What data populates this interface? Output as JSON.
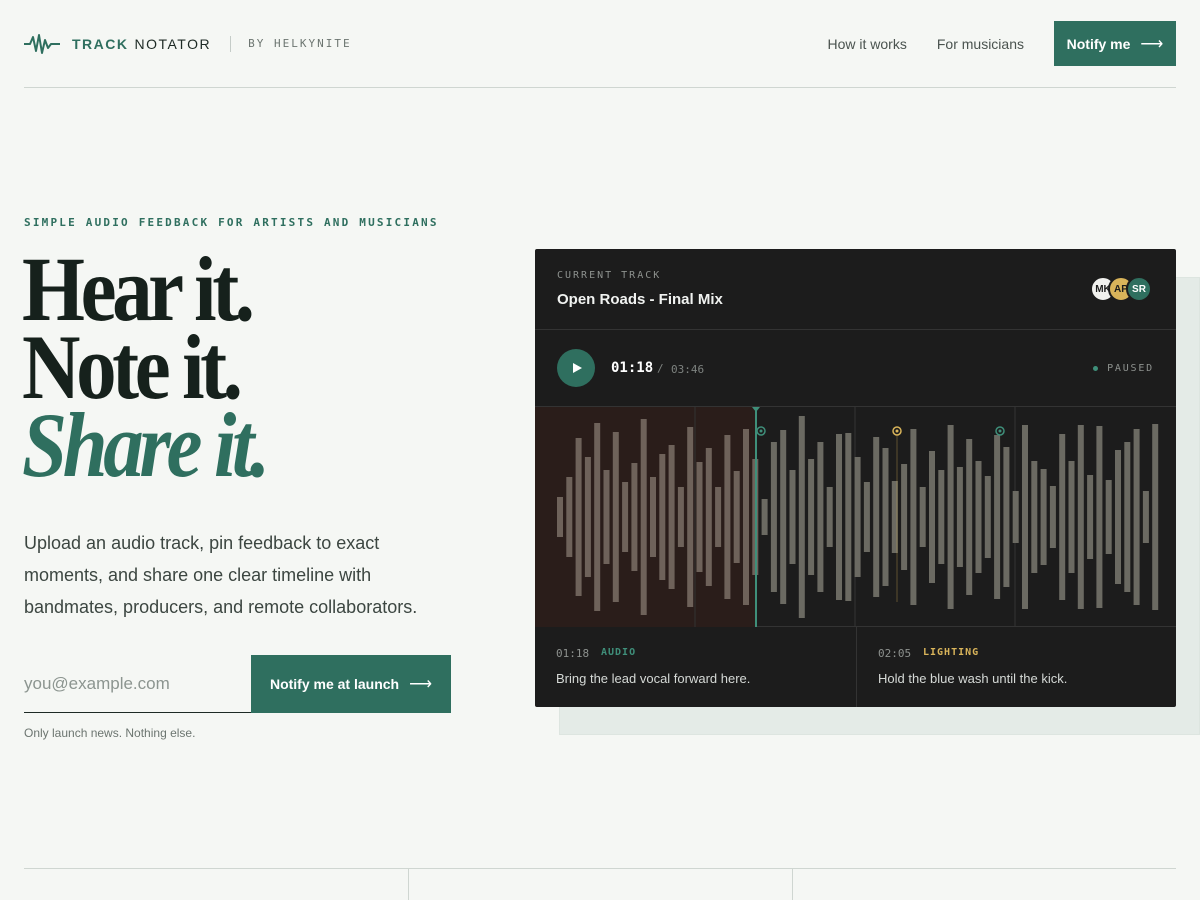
{
  "brand": {
    "track": "TRACK",
    "notator": "NOTATOR",
    "by": "BY HELKYNITE",
    "icon": "waveform-icon"
  },
  "nav": {
    "links": [
      "How it works",
      "For musicians"
    ],
    "cta": "Notify me"
  },
  "hero": {
    "eyebrow": "SIMPLE AUDIO FEEDBACK FOR ARTISTS AND MUSICIANS",
    "line1": "Hear it.",
    "line2": "Note it.",
    "line3": "Share it.",
    "subcopy": "Upload an audio track, pin feedback to exact moments, and share one clear timeline with bandmates, producers, and remote collaborators.",
    "email_placeholder": "you@example.com",
    "signup_cta": "Notify me at launch",
    "fineprint": "Only launch news. Nothing else."
  },
  "player": {
    "label": "CURRENT TRACK",
    "title": "Open Roads - Final Mix",
    "avatars": [
      {
        "initials": "MK",
        "bg": "#f1f1ee",
        "fg": "#1c1c1c"
      },
      {
        "initials": "AP",
        "bg": "#d9b45a",
        "fg": "#1c1c1c"
      },
      {
        "initials": "SR",
        "bg": "#2f6f5f",
        "fg": "#ffffff"
      }
    ],
    "current_time": "01:18",
    "separator": "/",
    "total_time": "03:46",
    "status": "PAUSED",
    "progress": 0.345,
    "notes": [
      {
        "time": "01:18",
        "tag": "AUDIO",
        "tag_color": "#3f8f7a",
        "text": "Bring the lead vocal forward here."
      },
      {
        "time": "02:05",
        "tag": "LIGHTING",
        "tag_color": "#d9b45a",
        "text": "Hold the blue wash until the kick."
      }
    ],
    "colors": {
      "played": "#7a6e66",
      "unplayed": "#6b6a62",
      "playhead": "#3f8f7a",
      "played_bg": "#2a1d1a",
      "lighting": "#d9b45a"
    }
  }
}
